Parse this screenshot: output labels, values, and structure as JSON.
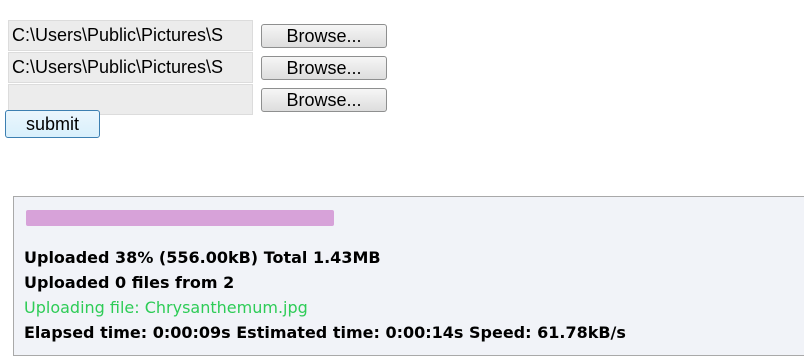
{
  "file_inputs": [
    {
      "value": "C:\\Users\\Public\\Pictures\\S",
      "button_label": "Browse..."
    },
    {
      "value": "C:\\Users\\Public\\Pictures\\S",
      "button_label": "Browse..."
    },
    {
      "value": "",
      "button_label": "Browse..."
    }
  ],
  "submit_label": "submit",
  "progress": {
    "percent": 38,
    "color": "#d7a2d9",
    "uploaded_text": "Uploaded 38% (556.00kB) Total 1.43MB",
    "files_text": "Uploaded 0 files from 2",
    "status_text": "Uploading file: Chrysanthemum.jpg",
    "status_color": "#2ecc57",
    "timing_text": "Elapsed time: 0:00:09s Estimated time: 0:00:14s Speed: 61.78kB/s"
  }
}
